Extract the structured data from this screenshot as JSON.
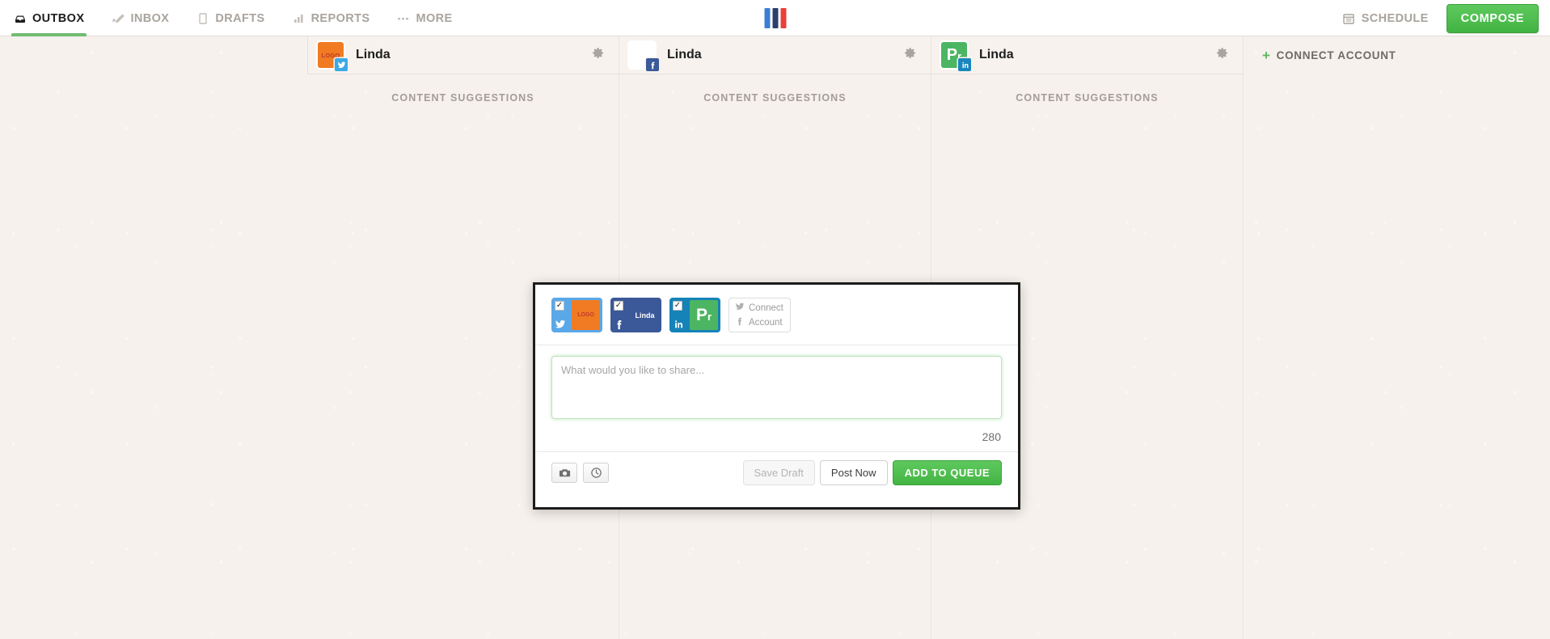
{
  "nav": {
    "tabs": [
      {
        "label": "OUTBOX",
        "icon": "outbox-icon",
        "active": true
      },
      {
        "label": "INBOX",
        "icon": "inbox-icon",
        "active": false
      },
      {
        "label": "DRAFTS",
        "icon": "drafts-icon",
        "active": false
      },
      {
        "label": "REPORTS",
        "icon": "reports-icon",
        "active": false
      },
      {
        "label": "MORE",
        "icon": "more-icon",
        "active": false
      }
    ],
    "brand": {
      "name": "brand-logo",
      "bars": [
        "#3b7fd4",
        "#2c3e6b",
        "#e8403a"
      ]
    },
    "schedule_label": "SCHEDULE",
    "compose_label": "COMPOSE",
    "accent_green": "#4fc04f",
    "active_underline": "#72bb72",
    "inactive_text": "#a9a49d"
  },
  "columns": [
    {
      "name": "Linda",
      "network": "twitter",
      "avatar_text": "LOGO",
      "avatar_style": "orange",
      "suggestions_label": "CONTENT SUGGESTIONS"
    },
    {
      "name": "Linda",
      "network": "facebook",
      "avatar_text": "",
      "avatar_style": "white",
      "suggestions_label": "CONTENT SUGGESTIONS"
    },
    {
      "name": "Linda",
      "network": "linkedin",
      "avatar_text": "Pr",
      "avatar_style": "green",
      "suggestions_label": "CONTENT SUGGESTIONS"
    }
  ],
  "connect_account": {
    "plus": "+",
    "label": "CONNECT ACCOUNT"
  },
  "compose_modal": {
    "accounts": [
      {
        "network": "twitter",
        "checked": "✓",
        "label": "",
        "avatar_text": "LOGO",
        "avatar_style": "orange",
        "tile_color": "#5aa8e8"
      },
      {
        "network": "facebook",
        "checked": "✓",
        "label": "Linda",
        "avatar_text": "",
        "avatar_style": "none",
        "tile_color": "#3b5998"
      },
      {
        "network": "linkedin",
        "checked": "✓",
        "label": "",
        "avatar_text": "Pr",
        "avatar_style": "green",
        "tile_color": "#1583b8"
      }
    ],
    "connect_tile": {
      "line1": "Connect",
      "line2": "Account"
    },
    "textarea": {
      "placeholder": "What would you like to share...",
      "value": ""
    },
    "char_count": "280",
    "toolbar": {
      "photo_icon": "camera-icon",
      "schedule_icon": "clock-icon"
    },
    "buttons": {
      "save_draft": "Save Draft",
      "post_now": "Post Now",
      "add_to_queue": "ADD TO QUEUE"
    }
  }
}
